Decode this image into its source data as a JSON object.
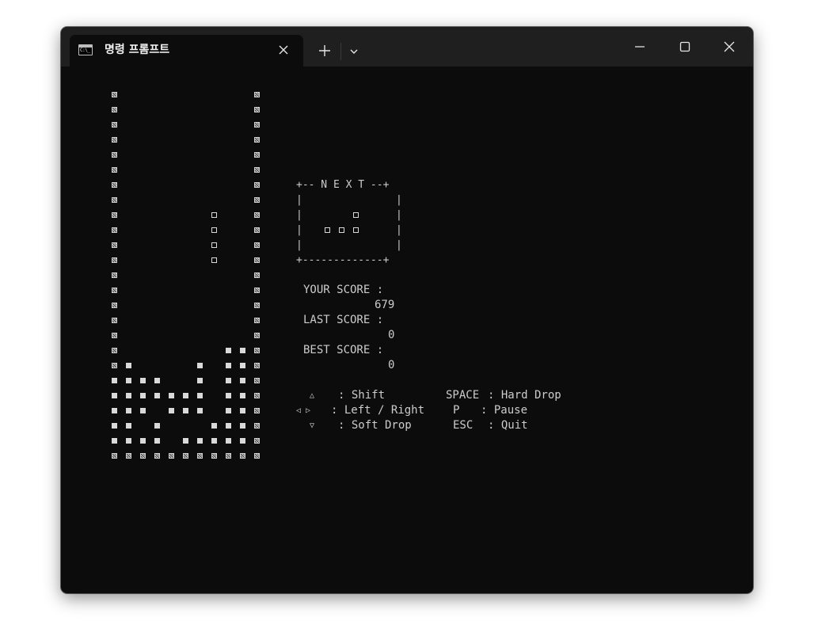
{
  "window": {
    "tab_title": "명령 프롬프트",
    "tab_icon_label": "C:\\_",
    "tab_icon": "terminal-icon",
    "close_tab_icon": "close-icon",
    "new_tab_icon": "plus-icon",
    "dropdown_icon": "chevron-down-icon",
    "minimize_icon": "minimize-icon",
    "maximize_icon": "maximize-icon",
    "close_window_icon": "close-icon"
  },
  "board": {
    "wall_glyph": "▩",
    "block_glyph": "■",
    "piece_glyph": "□",
    "left_wall_col": 0,
    "right_wall_col": 10,
    "rows": 25,
    "falling_piece": [
      [
        7,
        8
      ],
      [
        7,
        9
      ],
      [
        7,
        10
      ],
      [
        7,
        11
      ]
    ],
    "stack": [
      [
        8,
        17
      ],
      [
        9,
        17
      ],
      [
        1,
        18
      ],
      [
        6,
        18
      ],
      [
        8,
        18
      ],
      [
        9,
        18
      ],
      [
        0,
        19
      ],
      [
        1,
        19
      ],
      [
        2,
        19
      ],
      [
        3,
        19
      ],
      [
        6,
        19
      ],
      [
        8,
        19
      ],
      [
        9,
        19
      ],
      [
        0,
        20
      ],
      [
        1,
        20
      ],
      [
        2,
        20
      ],
      [
        3,
        20
      ],
      [
        4,
        20
      ],
      [
        5,
        20
      ],
      [
        6,
        20
      ],
      [
        8,
        20
      ],
      [
        9,
        20
      ],
      [
        0,
        21
      ],
      [
        1,
        21
      ],
      [
        2,
        21
      ],
      [
        4,
        21
      ],
      [
        5,
        21
      ],
      [
        6,
        21
      ],
      [
        8,
        21
      ],
      [
        9,
        21
      ],
      [
        0,
        22
      ],
      [
        1,
        22
      ],
      [
        3,
        22
      ],
      [
        7,
        22
      ],
      [
        8,
        22
      ],
      [
        9,
        22
      ],
      [
        0,
        23
      ],
      [
        1,
        23
      ],
      [
        2,
        23
      ],
      [
        3,
        23
      ],
      [
        5,
        23
      ],
      [
        6,
        23
      ],
      [
        7,
        23
      ],
      [
        8,
        23
      ],
      [
        9,
        23
      ]
    ],
    "floor_row": 24
  },
  "next_panel": {
    "top_border": "+-- N E X T --+",
    "side_char": "|",
    "bottom_border": "+-------------+",
    "piece_cells": [
      [
        2,
        1
      ],
      [
        0,
        2
      ],
      [
        1,
        2
      ],
      [
        2,
        2
      ]
    ]
  },
  "scores": {
    "your_label": "YOUR SCORE :",
    "your_value": "679",
    "last_label": "LAST SCORE :",
    "last_value": "0",
    "best_label": "BEST SCORE :",
    "best_value": "0"
  },
  "controls": {
    "up_key": "△",
    "up_action": ": Shift",
    "lr_keys": "◁ ▷",
    "lr_action": ": Left / Right",
    "down_key": "▽",
    "down_action": ": Soft Drop",
    "space_key": "SPACE",
    "space_action": ": Hard Drop",
    "p_key": "P",
    "p_action": ": Pause",
    "esc_key": "ESC",
    "esc_action": ": Quit"
  }
}
